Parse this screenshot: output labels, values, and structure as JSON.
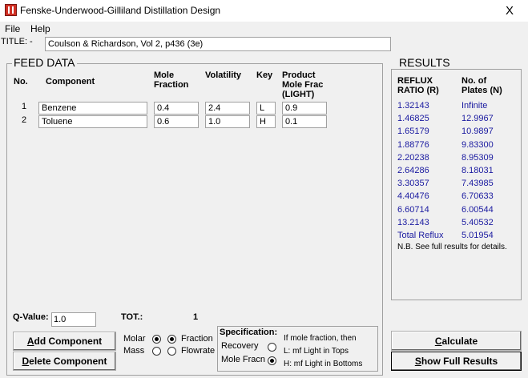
{
  "window": {
    "title": "Fenske-Underwood-Gilliland Distillation Design",
    "close_glyph": "X"
  },
  "menu": [
    {
      "label": "File"
    },
    {
      "label": "Help"
    }
  ],
  "title_field": {
    "label": "TITLE: -",
    "value": "Coulson & Richardson, Vol 2, p436 (3e)"
  },
  "feed": {
    "heading": "FEED DATA",
    "columns": {
      "no": "No.",
      "component": "Component",
      "mole_fraction": "Mole\nFraction",
      "volatility": "Volatility",
      "key": "Key",
      "product": "Product\nMole Frac\n(LIGHT)"
    },
    "rows": [
      {
        "no": "1",
        "component": "Benzene",
        "mole_fraction": "0.4",
        "volatility": "2.4",
        "key": "L",
        "product": "0.9"
      },
      {
        "no": "2",
        "component": "Toluene",
        "mole_fraction": "0.6",
        "volatility": "1.0",
        "key": "H",
        "product": "0.1"
      }
    ],
    "q_label": "Q-Value:",
    "q_value": "1.0",
    "tot_label": "TOT.:",
    "tot_value": "1"
  },
  "buttons": {
    "add_ul": "A",
    "add_rest": "dd Component",
    "delete_ul": "D",
    "delete_rest": "elete Component",
    "calculate_ul": "C",
    "calculate_rest": "alculate",
    "show_ul": "S",
    "show_rest": "how Full Results"
  },
  "basis": {
    "molar": "Molar",
    "mass": "Mass",
    "fraction": "Fraction",
    "flowrate": "Flowrate",
    "molar_checked": true,
    "fraction_checked": true
  },
  "specification": {
    "title": "Specification:",
    "recovery": "Recovery",
    "mole_fracn": "Mole Fracn",
    "note": "If mole fraction, then",
    "l_option": "L: mf Light in Tops",
    "h_option": "H: mf Light in Bottoms",
    "selected": "mole_fracn"
  },
  "results": {
    "heading": "RESULTS",
    "col_reflux": "REFLUX\nRATIO (R)",
    "col_plates": "No. of\nPlates (N)",
    "rows": [
      {
        "r": "1.32143",
        "n": "Infinite"
      },
      {
        "r": "1.46825",
        "n": "12.9967"
      },
      {
        "r": "1.65179",
        "n": "10.9897"
      },
      {
        "r": "1.88776",
        "n": "9.83300"
      },
      {
        "r": "2.20238",
        "n": "8.95309"
      },
      {
        "r": "2.64286",
        "n": "8.18031"
      },
      {
        "r": "3.30357",
        "n": "7.43985"
      },
      {
        "r": "4.40476",
        "n": "6.70633"
      },
      {
        "r": "6.60714",
        "n": "6.00544"
      },
      {
        "r": "13.2143",
        "n": "5.40532"
      },
      {
        "r": "Total Reflux",
        "n": "5.01954"
      }
    ],
    "note": "N.B.  See full results for details."
  }
}
